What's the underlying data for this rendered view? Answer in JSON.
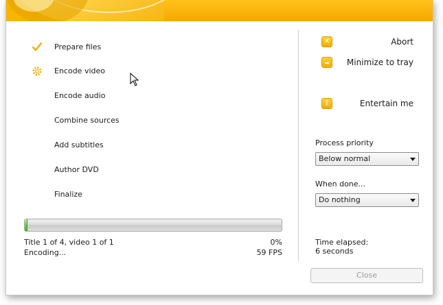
{
  "steps": [
    {
      "label": "Prepare files",
      "state": "done",
      "icon": "checkmark-icon"
    },
    {
      "label": "Encode video",
      "state": "active",
      "icon": "gear-icon"
    },
    {
      "label": "Encode audio",
      "state": "pending"
    },
    {
      "label": "Combine sources",
      "state": "pending"
    },
    {
      "label": "Add subtitles",
      "state": "pending"
    },
    {
      "label": "Author DVD",
      "state": "pending"
    },
    {
      "label": "Finalize",
      "state": "pending"
    }
  ],
  "progress": {
    "fraction": 0.0,
    "title_line": "Title 1 of 4, video 1 of 1",
    "status_line": "Encoding...",
    "percent_text": "0%",
    "fps_text": "59 FPS"
  },
  "actions": {
    "abort": {
      "label": "Abort",
      "icon": "close-x-icon"
    },
    "minimize": {
      "label": "Minimize to tray",
      "icon": "minimize-icon"
    },
    "entertain": {
      "label": "Entertain me",
      "icon": "more-dots-icon"
    }
  },
  "priority": {
    "label": "Process priority",
    "value": "Below normal"
  },
  "when_done": {
    "label": "When done...",
    "value": "Do nothing"
  },
  "elapsed": {
    "label": "Time elapsed:",
    "value": "6 seconds"
  },
  "close_button": {
    "label": "Close",
    "enabled": false
  },
  "colors": {
    "accent": "#f5a800",
    "progress_green": "#4cb52a",
    "disabled_text": "#9a9a9a"
  }
}
